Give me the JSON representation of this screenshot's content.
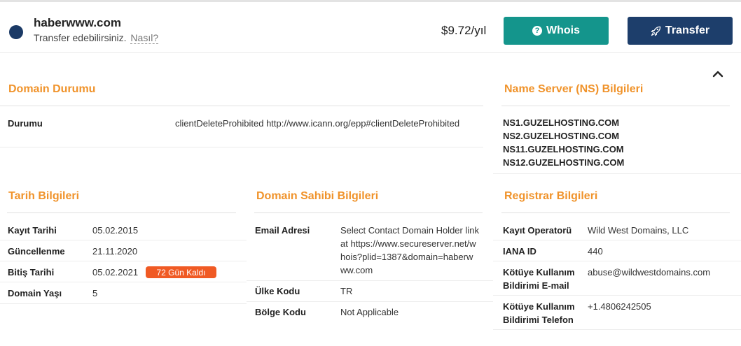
{
  "header": {
    "domain": "haberwww.com",
    "transfer_text": "Transfer edebilirsiniz.",
    "how_link": "Nasıl?",
    "price": "$9.72/yıl",
    "whois_label": "Whois",
    "transfer_label": "Transfer",
    "whois_color": "#14958c",
    "transfer_color": "#1d3e6b",
    "status_dot_color": "#1b3a66"
  },
  "domain_status": {
    "title": "Domain Durumu",
    "label": "Durumu",
    "value": "clientDeleteProhibited http://www.icann.org/epp#clientDeleteProhibited"
  },
  "nameservers": {
    "title": "Name Server (NS) Bilgileri",
    "items": [
      "NS1.GUZELHOSTING.COM",
      "NS2.GUZELHOSTING.COM",
      "NS11.GUZELHOSTING.COM",
      "NS12.GUZELHOSTING.COM"
    ]
  },
  "dates": {
    "title": "Tarih Bilgileri",
    "rows": [
      {
        "label": "Kayıt Tarihi",
        "value": "05.02.2015"
      },
      {
        "label": "Güncellenme",
        "value": "21.11.2020"
      },
      {
        "label": "Bitiş Tarihi",
        "value": "05.02.2021",
        "badge": "72 Gün Kaldı"
      },
      {
        "label": "Domain Yaşı",
        "value": "5"
      }
    ]
  },
  "owner": {
    "title": "Domain Sahibi Bilgileri",
    "rows": [
      {
        "label": "Email Adresi",
        "value": "Select Contact Domain Holder link at https://www.secureserver.net/whois?plid=1387&domain=haberwww.com"
      },
      {
        "label": "Ülke Kodu",
        "value": "TR"
      },
      {
        "label": "Bölge Kodu",
        "value": "Not Applicable"
      }
    ]
  },
  "registrar": {
    "title": "Registrar Bilgileri",
    "rows": [
      {
        "label": "Kayıt Operatorü",
        "value": "Wild West Domains, LLC"
      },
      {
        "label": "IANA ID",
        "value": "440"
      },
      {
        "label": "Kötüye Kullanım Bildirimi E-mail",
        "value": "abuse@wildwestdomains.com"
      },
      {
        "label": "Kötüye Kullanım Bildirimi Telefon",
        "value": "+1.4806242505"
      }
    ]
  },
  "accent_color": "#f0932b",
  "badge_color": "#f05a24"
}
